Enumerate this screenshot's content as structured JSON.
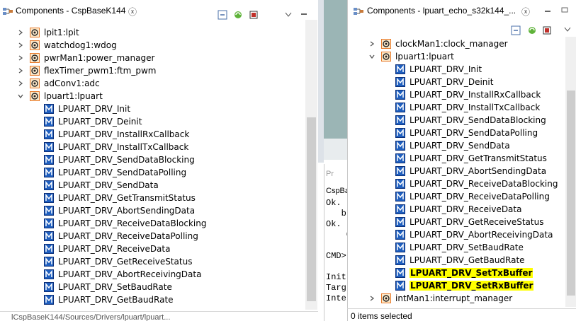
{
  "left_view": {
    "title": "Components - CspBaseK144",
    "close": "ⓧ",
    "nodes": [
      {
        "label": "lpit1:lpit",
        "kind": "component",
        "expanded": false
      },
      {
        "label": "watchdog1:wdog",
        "kind": "component",
        "expanded": false
      },
      {
        "label": "pwrMan1:power_manager",
        "kind": "component",
        "expanded": false
      },
      {
        "label": "flexTimer_pwm1:ftm_pwm",
        "kind": "component",
        "expanded": false
      },
      {
        "label": "adConv1:adc",
        "kind": "component",
        "expanded": false
      },
      {
        "label": "lpuart1:lpuart",
        "kind": "component",
        "expanded": true
      },
      {
        "label": "LPUART_DRV_Init",
        "kind": "method"
      },
      {
        "label": "LPUART_DRV_Deinit",
        "kind": "method"
      },
      {
        "label": "LPUART_DRV_InstallRxCallback",
        "kind": "method"
      },
      {
        "label": "LPUART_DRV_InstallTxCallback",
        "kind": "method"
      },
      {
        "label": "LPUART_DRV_SendDataBlocking",
        "kind": "method"
      },
      {
        "label": "LPUART_DRV_SendDataPolling",
        "kind": "method"
      },
      {
        "label": "LPUART_DRV_SendData",
        "kind": "method"
      },
      {
        "label": "LPUART_DRV_GetTransmitStatus",
        "kind": "method"
      },
      {
        "label": "LPUART_DRV_AbortSendingData",
        "kind": "method"
      },
      {
        "label": "LPUART_DRV_ReceiveDataBlocking",
        "kind": "method"
      },
      {
        "label": "LPUART_DRV_ReceiveDataPolling",
        "kind": "method"
      },
      {
        "label": "LPUART_DRV_ReceiveData",
        "kind": "method"
      },
      {
        "label": "LPUART_DRV_GetReceiveStatus",
        "kind": "method"
      },
      {
        "label": "LPUART_DRV_AbortReceivingData",
        "kind": "method"
      },
      {
        "label": "LPUART_DRV_SetBaudRate",
        "kind": "method"
      },
      {
        "label": "LPUART_DRV_GetBaudRate",
        "kind": "method"
      }
    ],
    "status": "lCspBaseK144/Sources/Drivers/lpuart/lpuart..."
  },
  "middle": {
    "problems_tab": "Pr",
    "console_tab": "CspBa",
    "console_lines": [
      "Ok.",
      "   b",
      "Ok.",
      "    C",
      "",
      "CMD>",
      "",
      "Init",
      "Targ",
      "Inte"
    ]
  },
  "right_view": {
    "title": "Components - lpuart_echo_s32k144_...",
    "close": "ⓧ",
    "nodes": [
      {
        "label": "clockMan1:clock_manager",
        "kind": "component",
        "expanded": false
      },
      {
        "label": "lpuart1:lpuart",
        "kind": "component",
        "expanded": true
      },
      {
        "label": "LPUART_DRV_Init",
        "kind": "method"
      },
      {
        "label": "LPUART_DRV_Deinit",
        "kind": "method"
      },
      {
        "label": "LPUART_DRV_InstallRxCallback",
        "kind": "method"
      },
      {
        "label": "LPUART_DRV_InstallTxCallback",
        "kind": "method"
      },
      {
        "label": "LPUART_DRV_SendDataBlocking",
        "kind": "method"
      },
      {
        "label": "LPUART_DRV_SendDataPolling",
        "kind": "method"
      },
      {
        "label": "LPUART_DRV_SendData",
        "kind": "method"
      },
      {
        "label": "LPUART_DRV_GetTransmitStatus",
        "kind": "method"
      },
      {
        "label": "LPUART_DRV_AbortSendingData",
        "kind": "method"
      },
      {
        "label": "LPUART_DRV_ReceiveDataBlocking",
        "kind": "method"
      },
      {
        "label": "LPUART_DRV_ReceiveDataPolling",
        "kind": "method"
      },
      {
        "label": "LPUART_DRV_ReceiveData",
        "kind": "method"
      },
      {
        "label": "LPUART_DRV_GetReceiveStatus",
        "kind": "method"
      },
      {
        "label": "LPUART_DRV_AbortReceivingData",
        "kind": "method"
      },
      {
        "label": "LPUART_DRV_SetBaudRate",
        "kind": "method"
      },
      {
        "label": "LPUART_DRV_GetBaudRate",
        "kind": "method"
      },
      {
        "label": "LPUART_DRV_SetTxBuffer",
        "kind": "method",
        "highlight": true
      },
      {
        "label": "LPUART_DRV_SetRxBuffer",
        "kind": "method",
        "highlight": true
      },
      {
        "label": "intMan1:interrupt_manager",
        "kind": "component",
        "expanded": false
      }
    ],
    "status": "0 items selected"
  },
  "colors": {
    "highlight": "#ffff00",
    "method_icon": "#1f5fbf",
    "component_icon": "#e87a2a",
    "separator": "#c8c8c8"
  },
  "icons": {
    "view": "components-icon",
    "collapse": "collapse-all-icon",
    "refresh": "refresh-icon",
    "filter": "filter-icon",
    "menu": "view-menu-icon"
  }
}
